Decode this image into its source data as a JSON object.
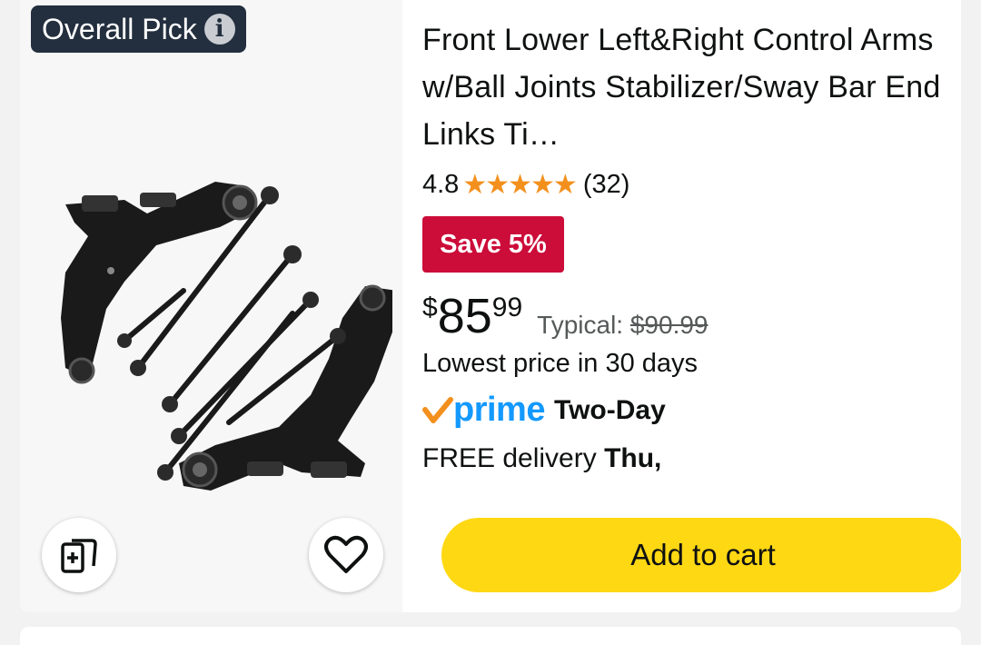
{
  "badge": {
    "label": "Overall Pick",
    "info_icon": "i"
  },
  "product": {
    "title": "Front Lower Left&Right Control Arms w/Ball Joints Stabilizer/Sway Bar End Links Ti…",
    "rating": "4.8",
    "stars": "★★★★★",
    "review_count": "(32)",
    "save_label": "Save 5%",
    "price_symbol": "$",
    "price_whole": "85",
    "price_fraction": "99",
    "typical_label": "Typical:",
    "typical_price": "$90.99",
    "lowest_note": "Lowest price in 30 days",
    "prime_label": "prime",
    "shipping_speed": "Two-Day",
    "delivery_prefix": "FREE delivery",
    "delivery_day": "Thu,",
    "add_to_cart_label": "Add to cart"
  },
  "colors": {
    "accent_red": "#cc0c39",
    "star_orange": "#f3901d",
    "prime_blue": "#1399ff",
    "cart_yellow": "#ffd814",
    "badge_dark": "#232f3e"
  },
  "icons": {
    "compare": "compare-add-icon",
    "wishlist": "heart-icon",
    "prime_check": "prime-check-icon"
  }
}
